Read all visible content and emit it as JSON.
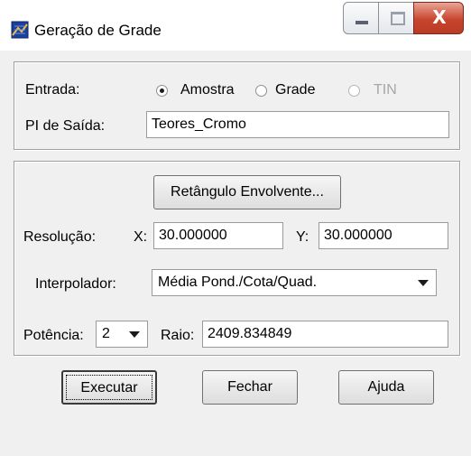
{
  "window": {
    "title": "Geração de Grade",
    "icon": "grid-app-icon",
    "controls": {
      "minimize": "minimize",
      "maximize": "maximize",
      "close": "X"
    }
  },
  "entrada": {
    "label": "Entrada:",
    "options": [
      {
        "label": "Amostra",
        "checked": true,
        "enabled": true
      },
      {
        "label": "Grade",
        "checked": false,
        "enabled": true
      },
      {
        "label": "TIN",
        "checked": false,
        "enabled": false
      }
    ]
  },
  "pi_saida": {
    "label": "PI de Saída:",
    "value": "Teores_Cromo"
  },
  "bounding_button": "Retângulo Envolvente...",
  "resolucao": {
    "label": "Resolução:",
    "x_label": "X:",
    "x_value": "30.000000",
    "y_label": "Y:",
    "y_value": "30.000000"
  },
  "interpolador": {
    "label": "Interpolador:",
    "value": "Média Pond./Cota/Quad."
  },
  "potencia": {
    "label": "Potência:",
    "value": "2"
  },
  "raio": {
    "label": "Raio:",
    "value": "2409.834849"
  },
  "buttons": {
    "execute": "Executar",
    "close": "Fechar",
    "help": "Ajuda"
  }
}
